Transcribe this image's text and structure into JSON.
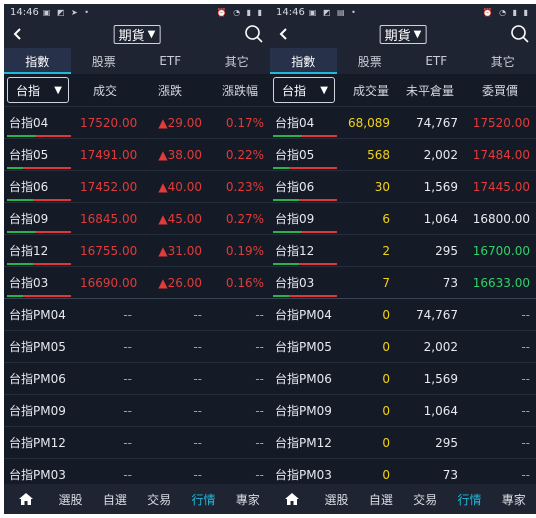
{
  "status_time": "14:46",
  "page_title": "期貨",
  "tabs": [
    "指數",
    "股票",
    "ETF",
    "其它"
  ],
  "selector_label": "台指",
  "left_headers": [
    "成交",
    "漲跌",
    "漲跌幅"
  ],
  "right_headers": [
    "成交量",
    "未平倉量",
    "委買價"
  ],
  "nav": [
    "選股",
    "自選",
    "交易",
    "行情",
    "專家"
  ],
  "active_nav": "行情",
  "colors": {
    "background": "#141a26",
    "accent": "#21b8d9",
    "up": "#e23b3b",
    "volume": "#f2d31a",
    "bid_green": "#2fd16a"
  },
  "rows": [
    {
      "name": "台指04",
      "price": "17520.00",
      "change": "▲29.00",
      "pct": "0.17%",
      "volume": "68,089",
      "oi": "74,767",
      "bid": "17520.00",
      "bid_color": "up",
      "bar": 0.45
    },
    {
      "name": "台指05",
      "price": "17491.00",
      "change": "▲38.00",
      "pct": "0.22%",
      "volume": "568",
      "oi": "2,002",
      "bid": "17484.00",
      "bid_color": "up",
      "bar": 0.25
    },
    {
      "name": "台指06",
      "price": "17452.00",
      "change": "▲40.00",
      "pct": "0.23%",
      "volume": "30",
      "oi": "1,569",
      "bid": "17445.00",
      "bid_color": "up",
      "bar": 0.4
    },
    {
      "name": "台指09",
      "price": "16845.00",
      "change": "▲45.00",
      "pct": "0.27%",
      "volume": "6",
      "oi": "1,064",
      "bid": "16800.00",
      "bid_color": "white",
      "bar": 0.45
    },
    {
      "name": "台指12",
      "price": "16755.00",
      "change": "▲31.00",
      "pct": "0.19%",
      "volume": "2",
      "oi": "295",
      "bid": "16700.00",
      "bid_color": "green",
      "bar": 0.4
    },
    {
      "name": "台指03",
      "price": "16690.00",
      "change": "▲26.00",
      "pct": "0.16%",
      "volume": "7",
      "oi": "73",
      "bid": "16633.00",
      "bid_color": "green",
      "bar": 0.25
    },
    {
      "name": "台指PM04",
      "price": "--",
      "change": "--",
      "pct": "--",
      "volume": "0",
      "oi": "74,767",
      "bid": "--",
      "bid_color": "dash"
    },
    {
      "name": "台指PM05",
      "price": "--",
      "change": "--",
      "pct": "--",
      "volume": "0",
      "oi": "2,002",
      "bid": "--",
      "bid_color": "dash"
    },
    {
      "name": "台指PM06",
      "price": "--",
      "change": "--",
      "pct": "--",
      "volume": "0",
      "oi": "1,569",
      "bid": "--",
      "bid_color": "dash"
    },
    {
      "name": "台指PM09",
      "price": "--",
      "change": "--",
      "pct": "--",
      "volume": "0",
      "oi": "1,064",
      "bid": "--",
      "bid_color": "dash"
    },
    {
      "name": "台指PM12",
      "price": "--",
      "change": "--",
      "pct": "--",
      "volume": "0",
      "oi": "295",
      "bid": "--",
      "bid_color": "dash"
    },
    {
      "name": "台指PM03",
      "price": "--",
      "change": "--",
      "pct": "--",
      "volume": "0",
      "oi": "73",
      "bid": "--",
      "bid_color": "dash"
    }
  ]
}
